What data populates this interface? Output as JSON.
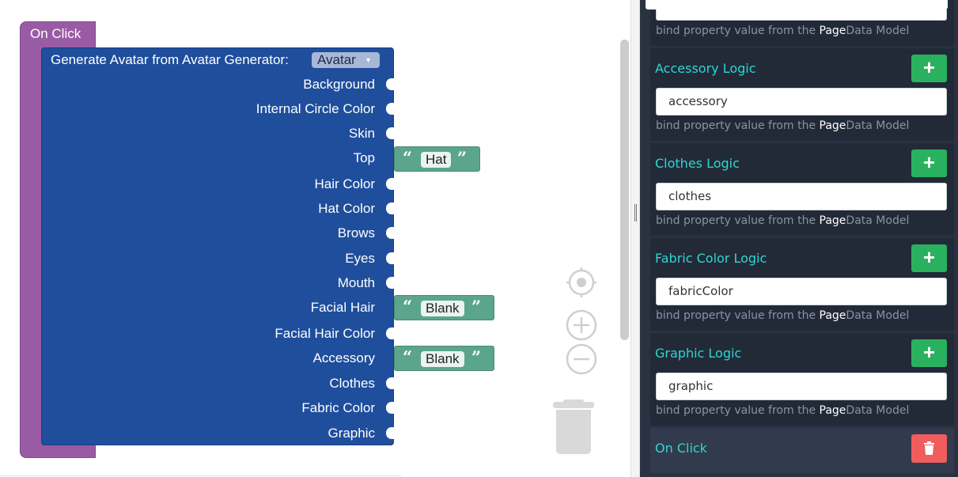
{
  "workspace": {
    "event_block": {
      "label": "On Click"
    },
    "generator_block": {
      "title": "Generate Avatar from Avatar Generator:",
      "dropdown_value": "Avatar",
      "inputs": [
        {
          "label": "Background"
        },
        {
          "label": "Internal Circle Color"
        },
        {
          "label": "Skin"
        },
        {
          "label": "Top",
          "value": "Hat"
        },
        {
          "label": "Hair Color"
        },
        {
          "label": "Hat Color"
        },
        {
          "label": "Brows"
        },
        {
          "label": "Eyes"
        },
        {
          "label": "Mouth"
        },
        {
          "label": "Facial Hair",
          "value": "Blank"
        },
        {
          "label": "Facial Hair Color"
        },
        {
          "label": "Accessory",
          "value": "Blank"
        },
        {
          "label": "Clothes"
        },
        {
          "label": "Fabric Color"
        },
        {
          "label": "Graphic"
        }
      ]
    },
    "text_block_quote_open": "“",
    "text_block_quote_close": "”",
    "controls": {
      "recenter_icon": "crosshair-icon",
      "zoom_in_icon": "plus-icon",
      "zoom_out_icon": "minus-icon",
      "trash_icon": "trash-icon"
    }
  },
  "panel": {
    "hint_prefix": "bind property value from the ",
    "hint_bold": "Page",
    "hint_suffix": "Data Model",
    "sections": [
      {
        "title": "Accessory Logic",
        "value": "accessory"
      },
      {
        "title": "Clothes Logic",
        "value": "clothes"
      },
      {
        "title": "Fabric Color Logic",
        "value": "fabricColor"
      },
      {
        "title": "Graphic Logic",
        "value": "graphic"
      }
    ],
    "add_label": "+",
    "event_section": {
      "title": "On Click"
    }
  },
  "colors": {
    "event_block": "#9a5ba5",
    "generator_block": "#1f4e9c",
    "text_block": "#5ba58c",
    "panel_bg": "#2a3242",
    "section_title": "#2fd6d0",
    "add_button": "#2ab160",
    "delete_button": "#f15c5c"
  }
}
